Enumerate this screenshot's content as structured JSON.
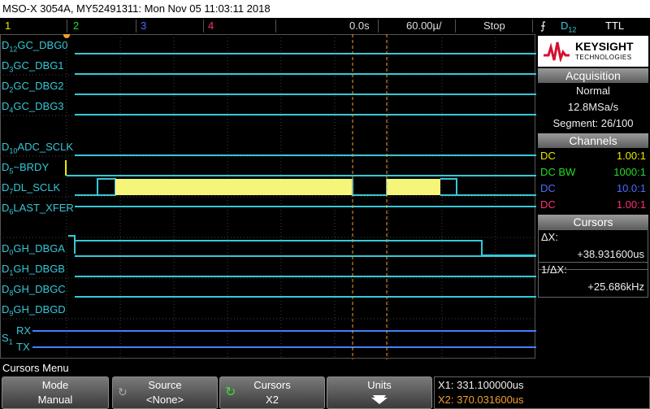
{
  "title": "MSO-X 3054A, MY52491311: Mon Nov 05 11:03:11 2018",
  "channel_bar": {
    "ch1": "1",
    "ch2": "2",
    "ch3": "3",
    "ch4": "4",
    "time_position": "0.0s",
    "time_scale": "60.00µ/",
    "run_state": "Stop",
    "trigger_source": "D",
    "trigger_source_sub": "12",
    "trigger_level": "TTL"
  },
  "colors": {
    "ch1": "#e8e800",
    "ch2": "#22dd22",
    "ch3": "#4a6cff",
    "ch4": "#ff3070",
    "digital": "#36c8d8",
    "cursor": "#f0a030",
    "serial": "#4a7cff"
  },
  "channels": [
    {
      "prefix": "D",
      "sub": "12",
      "name": "GC_DBG0"
    },
    {
      "prefix": "D",
      "sub": "3",
      "name": "GC_DBG1"
    },
    {
      "prefix": "D",
      "sub": "2",
      "name": "GC_DBG2"
    },
    {
      "prefix": "D",
      "sub": "4",
      "name": "GC_DBG3"
    },
    {
      "prefix": "D",
      "sub": "10",
      "name": "ADC_SCLK"
    },
    {
      "prefix": "D",
      "sub": "5",
      "name": "~BRDY"
    },
    {
      "prefix": "D",
      "sub": "7",
      "name": "DL_SCLK"
    },
    {
      "prefix": "D",
      "sub": "6",
      "name": "LAST_XFER"
    },
    {
      "prefix": "D",
      "sub": "0",
      "name": "GH_DBGA"
    },
    {
      "prefix": "D",
      "sub": "1",
      "name": "GH_DBGB"
    },
    {
      "prefix": "D",
      "sub": "8",
      "name": "GH_DBGC"
    },
    {
      "prefix": "D",
      "sub": "9",
      "name": "GH_DBGD"
    }
  ],
  "serial": {
    "prefix": "S",
    "sub": "1",
    "rx": "RX",
    "tx": "TX"
  },
  "brand": {
    "name": "KEYSIGHT",
    "sub": "TECHNOLOGIES"
  },
  "acquisition": {
    "header": "Acquisition",
    "mode": "Normal",
    "rate": "12.8MSa/s",
    "segment": "Segment: 26/100"
  },
  "channels_panel": {
    "header": "Channels",
    "rows": [
      {
        "coupling": "DC",
        "probe": "1.00:1",
        "color": "#e8e800"
      },
      {
        "coupling": "DC BW",
        "probe": "1000:1",
        "color": "#22dd22"
      },
      {
        "coupling": "DC",
        "probe": "10.0:1",
        "color": "#4a6cff"
      },
      {
        "coupling": "DC",
        "probe": "1.00:1",
        "color": "#ff3070"
      }
    ]
  },
  "cursors": {
    "header": "Cursors",
    "dx_label": "ΔX:",
    "dx_value": "+38.931600us",
    "inv_label": "1/ΔX:",
    "inv_value": "+25.686kHz",
    "x1": "X1: 331.100000us",
    "x2": "X2: 370.031600us"
  },
  "menu_title": "Cursors Menu",
  "softkeys": {
    "mode": {
      "label": "Mode",
      "value": "Manual"
    },
    "source": {
      "label": "Source",
      "value": "<None>"
    },
    "cursors": {
      "label": "Cursors",
      "value": "X2"
    },
    "units": {
      "label": "Units"
    }
  }
}
